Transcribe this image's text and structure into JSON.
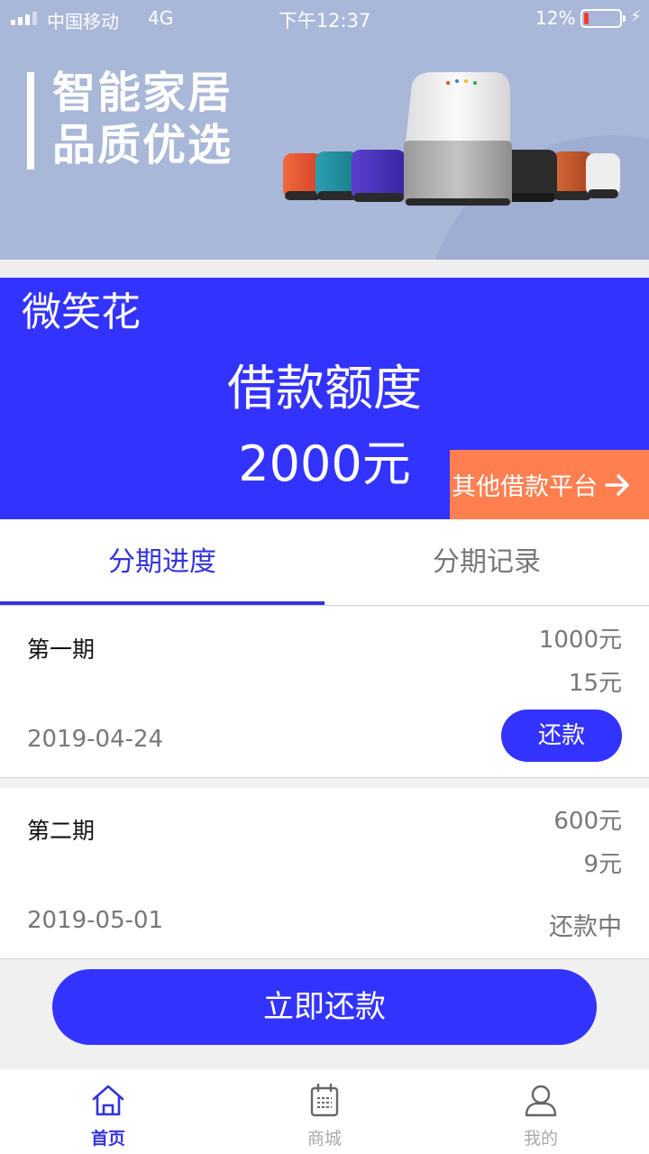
{
  "status_bar": {
    "carrier": "中国移动",
    "network": "4G",
    "time": "下午12:37",
    "battery": "12%",
    "battery_level": 0.12
  },
  "banner": {
    "line1": "智能家居",
    "line2": "品质优选"
  },
  "credit": {
    "brand": "微笑花",
    "limit_label": "借款额度",
    "limit_value": "2000元",
    "other_platform": "其他借款平台"
  },
  "tabs": [
    {
      "label": "分期进度",
      "active": true
    },
    {
      "label": "分期记录",
      "active": false
    }
  ],
  "installments": [
    {
      "period": "第一期",
      "amount": "1000元",
      "fee": "15元",
      "date": "2019-04-24",
      "action": "还款"
    },
    {
      "period": "第二期",
      "amount": "600元",
      "fee": "9元",
      "date": "2019-05-01",
      "status": "还款中"
    }
  ],
  "repay_now": "立即还款",
  "nav": [
    {
      "label": "首页",
      "icon": "home-icon",
      "active": true
    },
    {
      "label": "商城",
      "icon": "calendar-icon",
      "active": false
    },
    {
      "label": "我的",
      "icon": "user-icon",
      "active": false
    }
  ],
  "colors": {
    "primary": "#3333ff",
    "accent": "#ff7f50",
    "banner": "#a9b7d8"
  }
}
